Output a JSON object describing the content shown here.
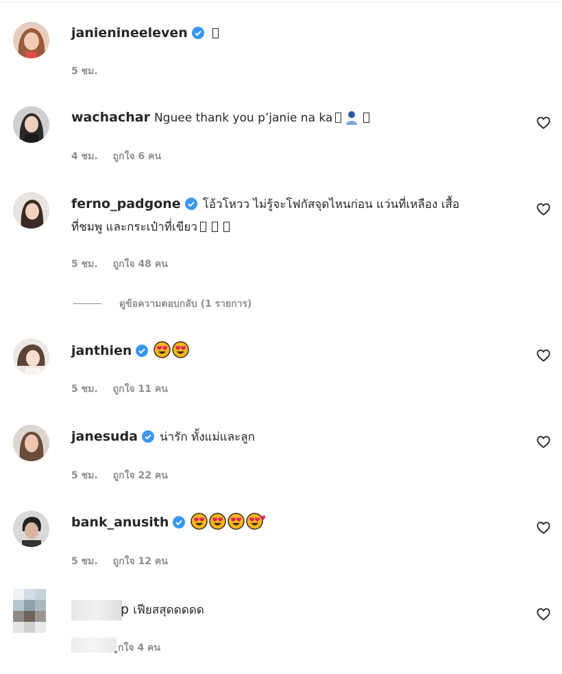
{
  "comments": [
    {
      "username": "janienineeleven",
      "verified": true,
      "text": "",
      "time": "5 ชม.",
      "likes": "",
      "has_heart": false
    },
    {
      "username": "wachachar",
      "verified": false,
      "text": "Nguee thank you p’janie na ka",
      "time": "4 ชม.",
      "likes": "ถูกใจ 6 คน",
      "has_heart": true
    },
    {
      "username": "ferno_padgone",
      "verified": true,
      "text": "โอ้วโหวว ไม่รู้จะโฟกัสจุดไหนก่อน แว่นที่เหลือง เสื้อ",
      "text_line2": "ที่ชมพู และกระเป๋าที่เขียว",
      "time": "5 ชม.",
      "likes": "ถูกใจ 48 คน",
      "has_heart": true
    },
    {
      "username": "janthien",
      "verified": true,
      "text": "",
      "time": "5 ชม.",
      "likes": "ถูกใจ 11 คน",
      "has_heart": true
    },
    {
      "username": "janesuda",
      "verified": true,
      "text": "น่ารัก ทั้งแม่และลูก",
      "time": "5 ชม.",
      "likes": "ถูกใจ 22 คน",
      "has_heart": true
    },
    {
      "username": "bank_anusith",
      "verified": true,
      "text": "",
      "time": "5 ชม.",
      "likes": "ถูกใจ 12 คน",
      "has_heart": true
    },
    {
      "username": "p",
      "verified": false,
      "text": "เฟียสสุดดดดด",
      "time": "",
      "likes": "ูกใจ 4 คน",
      "has_heart": true
    }
  ],
  "view_replies": "ดูข้อความตอบกลับ (1 รายการ)",
  "colors": {
    "text": "#262626",
    "secondary": "#8e8e8e",
    "verified": "#3897f0",
    "emoji_face": "#f5b51f",
    "emoji_heart_eye": "#e0245e"
  },
  "icons": {
    "heart": "heart-outline-icon",
    "verified": "verified-badge-icon",
    "emoji": "heart-eyes-emoji-icon"
  }
}
